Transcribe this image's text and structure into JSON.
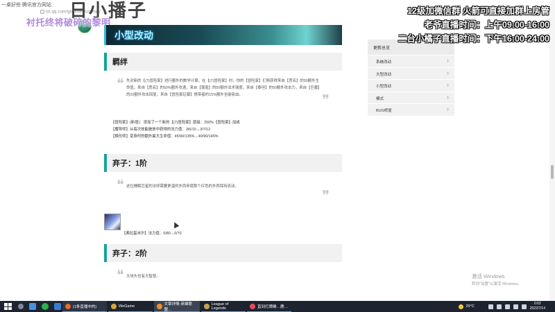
{
  "browser": {
    "tab_title": "一桌好些 腾讯官方网站",
    "url": "lol.qq.com/gicp/news/detail/...",
    "page_heading": "日小播子"
  },
  "overlay": {
    "purple_text": "衬托终将破碎的黎明",
    "stream_line1": "12级加微信群 火箭可直接加群上房管",
    "stream_line2": "老爷直播时间：上午09:00-16:00",
    "stream_line3": "二台小橘子直播时间：下午16:00-24:00"
  },
  "article": {
    "banner_title": "小型改动",
    "sections": [
      {
        "title": "羁绊",
        "quote": "先对新的【(7)冒险家】进行额外的数学计算。在【(7)冒险家】时，你的【冒险家】们将获得来自【恶名】的50额外生命值，来自【恶名】的50%额外攻速，来自【锻造】的50额外法术强度，来自【泰坦】的50额外攻击力，来自【巨魔】的20额外攻击回复，来自【冒险家征募】携带者的15%额外全能吸血。"
      }
    ],
    "changes": [
      "【冒险家】(新增)：添加了一个新的【(7)冒险家】层级：250%【冒险家】加成",
      "【魔导师】从每次技能施放中获得的法力值：3/6/10→3/7/12",
      "【换形师】变身时的额外最大生命值：45/90/135%→40/90/145%"
    ],
    "tier1": {
      "title": "弃子：1阶",
      "quote": "这位睡眠巨星的法师需要更温的东西来使那个红色的东西保持流动。",
      "champ_change": "【弗拉基米尔】法力值：0/80→0/70"
    },
    "tier2": {
      "title": "弃子：2阶",
      "quote": "大块头也有大智慧。"
    }
  },
  "sidebar": {
    "heading": "更新总览",
    "items": [
      "系统改动",
      "大型改动",
      "小型改动",
      "模式",
      "BUG修复"
    ]
  },
  "activation": {
    "line1": "激活 Windows",
    "line2": "转到\"设置\"以激活 Windows。"
  },
  "taskbar": {
    "apps": [
      {
        "label": "(1条直播中的)",
        "color": "#e86b2a"
      },
      {
        "label": "WeGame",
        "color": "#d8a33c"
      },
      {
        "label": "文章详情-英雄联盟...",
        "color": "#f08c2c"
      },
      {
        "label": "League of Legends",
        "color": "#c8a24a"
      },
      {
        "label": "直到灯牌确…鹿…",
        "color": "#e84a5a"
      }
    ],
    "temperature": "29°C",
    "time": "0:02",
    "date": "2022/7/14"
  }
}
